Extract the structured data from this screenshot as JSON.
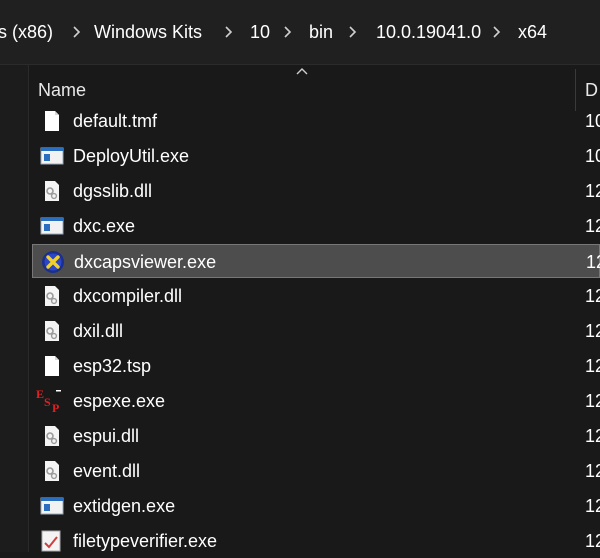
{
  "address": {
    "crumbs": [
      "s (x86)",
      "Windows Kits",
      "10",
      "bin",
      "10.0.19041.0",
      "x64"
    ]
  },
  "columns": {
    "name": "Name",
    "date": "D"
  },
  "files": [
    {
      "name": "default.tmf",
      "date": "10",
      "icon": "document-icon"
    },
    {
      "name": "DeployUtil.exe",
      "date": "10",
      "icon": "application-icon"
    },
    {
      "name": "dgsslib.dll",
      "date": "12",
      "icon": "dll-gear-icon"
    },
    {
      "name": "dxc.exe",
      "date": "12",
      "icon": "application-icon"
    },
    {
      "name": "dxcapsviewer.exe",
      "date": "12",
      "icon": "directx-icon",
      "selected": true
    },
    {
      "name": "dxcompiler.dll",
      "date": "12",
      "icon": "dll-gear-icon"
    },
    {
      "name": "dxil.dll",
      "date": "12",
      "icon": "dll-gear-icon"
    },
    {
      "name": "esp32.tsp",
      "date": "12",
      "icon": "document-icon"
    },
    {
      "name": "espexe.exe",
      "date": "12",
      "icon": "esp-logo-icon"
    },
    {
      "name": "espui.dll",
      "date": "12",
      "icon": "dll-gear-icon"
    },
    {
      "name": "event.dll",
      "date": "12",
      "icon": "dll-gear-icon"
    },
    {
      "name": "extidgen.exe",
      "date": "12",
      "icon": "application-icon"
    },
    {
      "name": "filetypeverifier.exe",
      "date": "12",
      "icon": "verifier-app-icon"
    }
  ],
  "colors": {
    "background": "#191919",
    "selection": "#4d4d4d",
    "text": "#ffffff"
  }
}
